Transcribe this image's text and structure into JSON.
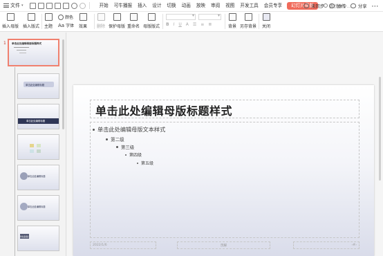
{
  "menubar": {
    "file": "文件",
    "tabs": [
      "开始",
      "可牛播报",
      "插入",
      "设计",
      "切换",
      "动画",
      "放映",
      "审阅",
      "视图",
      "开发工具",
      "会员专享"
    ],
    "active_tab": "幻灯片母版",
    "search": "查找命令...",
    "sync": "未同步",
    "collab": "协作",
    "share": "分享",
    "more": "···"
  },
  "ribbon": {
    "insert_master": "插入母版",
    "insert_layout": "插入版式",
    "theme": "主题",
    "colors": "颜色",
    "fonts": "字体",
    "effects": "效果",
    "delete": "删除",
    "preserve": "保护母版",
    "rename": "重命名",
    "master_layout": "母版版式",
    "font_bold": "B",
    "font_italic": "I",
    "font_underline": "U",
    "background": "背景",
    "save_background": "另存背景",
    "close": "关闭"
  },
  "panel": {
    "slide_number": "1",
    "thumbnails": [
      {
        "title": "单击此处编辑母版标题样式"
      },
      {
        "title": "单击此处编辑标题"
      },
      {
        "title": "单击此处编辑标题"
      },
      {
        "title": ""
      },
      {
        "title": "单击此处编辑标题"
      },
      {
        "title": "单击此处编辑标题"
      },
      {
        "title": "单击此处编辑标题"
      }
    ]
  },
  "slide": {
    "title": "单击此处编辑母版标题样式",
    "levels": [
      "单击此处编辑母版文本样式",
      "第二级",
      "第三级",
      "第四级",
      "第五级"
    ],
    "footer_date": "2022/1/6",
    "footer_center": "页脚",
    "footer_num": "‹#›"
  }
}
